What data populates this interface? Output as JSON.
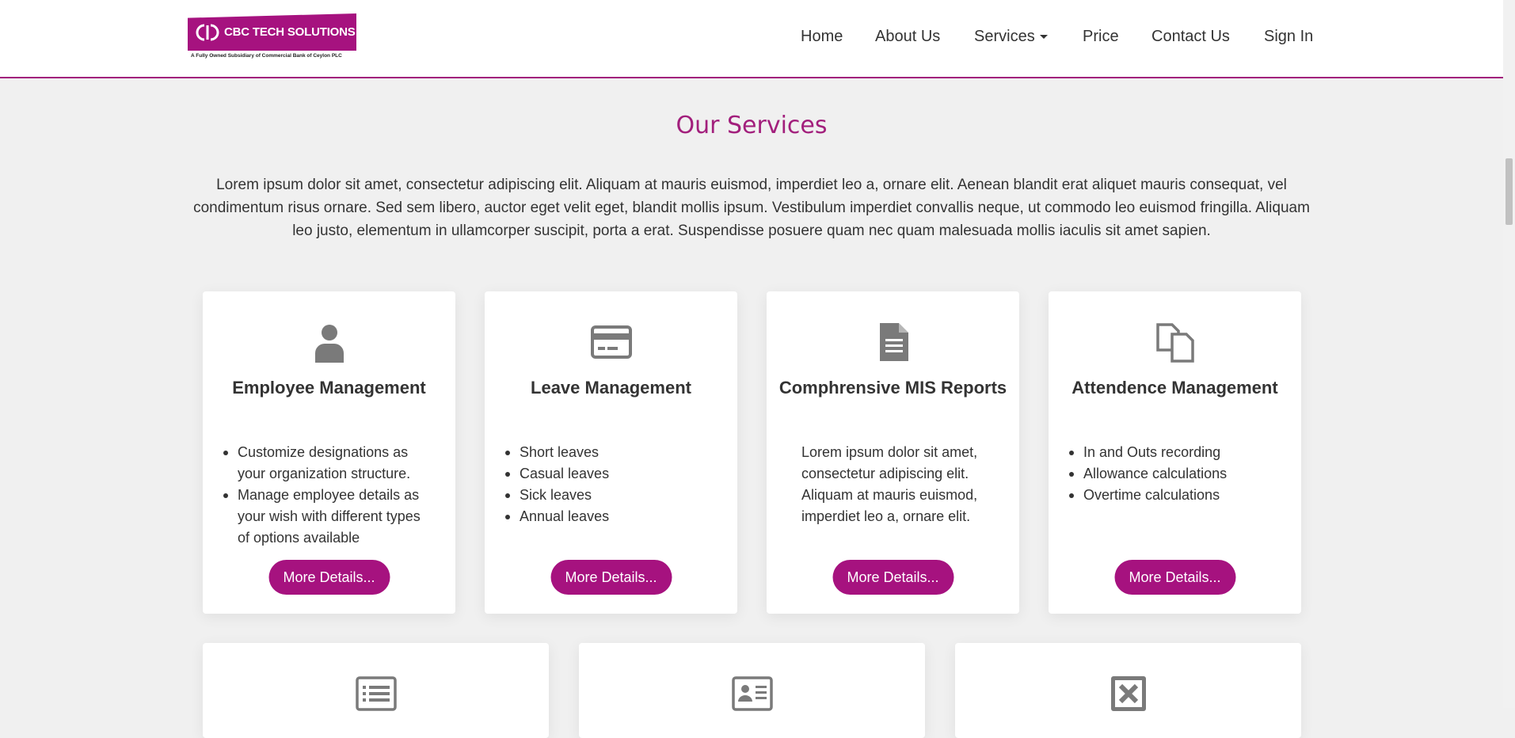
{
  "brand": {
    "name": "CBC TECH SOLUTIONS",
    "tagline": "A Fully Owned Subsidiary of Commercial Bank of Ceylon PLC",
    "accent": "#a6127f"
  },
  "nav": {
    "items": [
      "Home",
      "About Us",
      "Services",
      "Price",
      "Contact Us",
      "Sign In"
    ]
  },
  "section": {
    "title": "Our Services",
    "intro": "Lorem ipsum dolor sit amet, consectetur adipiscing elit. Aliquam at mauris euismod, imperdiet leo a, ornare elit. Aenean blandit erat aliquet mauris consequat, vel condimentum risus ornare. Sed sem libero, auctor eget velit eget, blandit mollis ipsum. Vestibulum imperdiet convallis neque, ut commodo leo euismod fringilla. Aliquam leo justo, elementum in ullamcorper suscipit, porta a erat. Suspendisse posuere quam nec quam malesuada mollis iaculis sit amet sapien."
  },
  "cards": [
    {
      "icon": "user-icon",
      "title": "Employee Management",
      "items": [
        "Customize designations as your organization structure.",
        "Manage employee details as your wish with different types of options available"
      ],
      "button": "More Details..."
    },
    {
      "icon": "credit-card-icon",
      "title": "Leave Management",
      "items": [
        "Short leaves",
        "Casual leaves",
        "Sick leaves",
        "Annual leaves"
      ],
      "button": "More Details..."
    },
    {
      "icon": "file-text-icon",
      "title": "Comphrensive MIS Reports",
      "text": "Lorem ipsum dolor sit amet, consectetur adipiscing elit. Aliquam at mauris euismod, imperdiet leo a, ornare elit.",
      "button": "More Details..."
    },
    {
      "icon": "files-icon",
      "title": "Attendence Management",
      "items": [
        "In and Outs recording",
        "Allowance calculations",
        "Overtime calculations"
      ],
      "button": "More Details..."
    }
  ],
  "cards_row2": [
    {
      "icon": "list-icon"
    },
    {
      "icon": "id-card-icon"
    },
    {
      "icon": "close-box-icon"
    }
  ]
}
